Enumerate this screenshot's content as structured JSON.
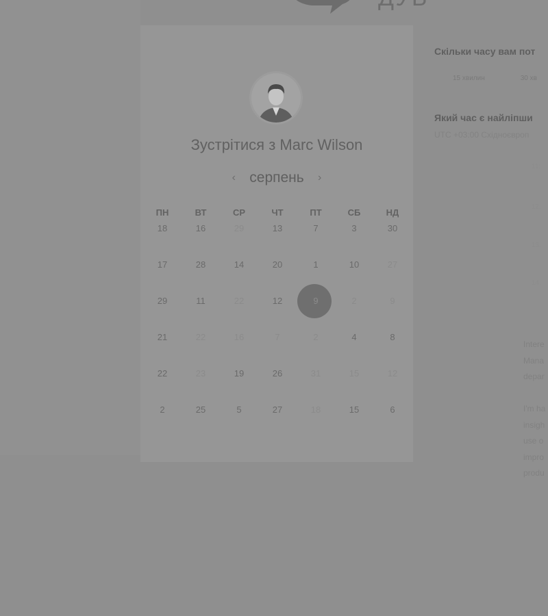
{
  "brand": {
    "logo_text": "ДУБ"
  },
  "calendar": {
    "title": "Зустрітися з Marc Wilson",
    "month": "серпень",
    "prev_label": "‹",
    "next_label": "›",
    "weekdays": [
      "ПН",
      "ВТ",
      "СР",
      "ЧТ",
      "ПТ",
      "СБ",
      "НД"
    ],
    "weeks": [
      [
        {
          "d": "18",
          "off": false
        },
        {
          "d": "16",
          "off": false
        },
        {
          "d": "29",
          "off": true
        },
        {
          "d": "13",
          "off": false
        },
        {
          "d": "7",
          "off": false
        },
        {
          "d": "3",
          "off": false
        },
        {
          "d": "30",
          "off": false
        }
      ],
      [
        {
          "d": "17",
          "off": false
        },
        {
          "d": "28",
          "off": false
        },
        {
          "d": "14",
          "off": false
        },
        {
          "d": "20",
          "off": false
        },
        {
          "d": "1",
          "off": false
        },
        {
          "d": "10",
          "off": false
        },
        {
          "d": "27",
          "off": true
        }
      ],
      [
        {
          "d": "29",
          "off": false
        },
        {
          "d": "11",
          "off": false
        },
        {
          "d": "22",
          "off": true
        },
        {
          "d": "12",
          "off": false
        },
        {
          "d": "9",
          "off": false,
          "selected": true
        },
        {
          "d": "2",
          "off": true
        },
        {
          "d": "9",
          "off": true
        }
      ],
      [
        {
          "d": "21",
          "off": false
        },
        {
          "d": "22",
          "off": true
        },
        {
          "d": "16",
          "off": true
        },
        {
          "d": "7",
          "off": true
        },
        {
          "d": "2",
          "off": true
        },
        {
          "d": "4",
          "off": false
        },
        {
          "d": "8",
          "off": false
        }
      ],
      [
        {
          "d": "22",
          "off": false
        },
        {
          "d": "23",
          "off": true
        },
        {
          "d": "19",
          "off": false
        },
        {
          "d": "26",
          "off": false
        },
        {
          "d": "31",
          "off": true
        },
        {
          "d": "15",
          "off": true
        },
        {
          "d": "12",
          "off": true
        }
      ],
      [
        {
          "d": "2",
          "off": false
        },
        {
          "d": "25",
          "off": false
        },
        {
          "d": "5",
          "off": false
        },
        {
          "d": "27",
          "off": false
        },
        {
          "d": "18",
          "off": true
        },
        {
          "d": "15",
          "off": false
        },
        {
          "d": "6",
          "off": false
        }
      ]
    ],
    "selected_day": "9"
  },
  "booking": {
    "duration_question": "Скільки часу вам пот",
    "durations": [
      "15 хвилин",
      "30 хв"
    ],
    "time_question": "Який час є найліпши",
    "timezone": "UTC +03:00 Східноєвроп",
    "slots": [
      "11:",
      "12:",
      "13:",
      "14:"
    ],
    "description_lines": [
      "Intere",
      "Mana",
      "depar",
      "",
      "I'm ha",
      "insigh",
      "use o",
      "impro",
      "produ"
    ]
  },
  "colors": {
    "overlay": "#8f8f8f",
    "panel": "#969696",
    "selected": "#6f6f6f"
  }
}
